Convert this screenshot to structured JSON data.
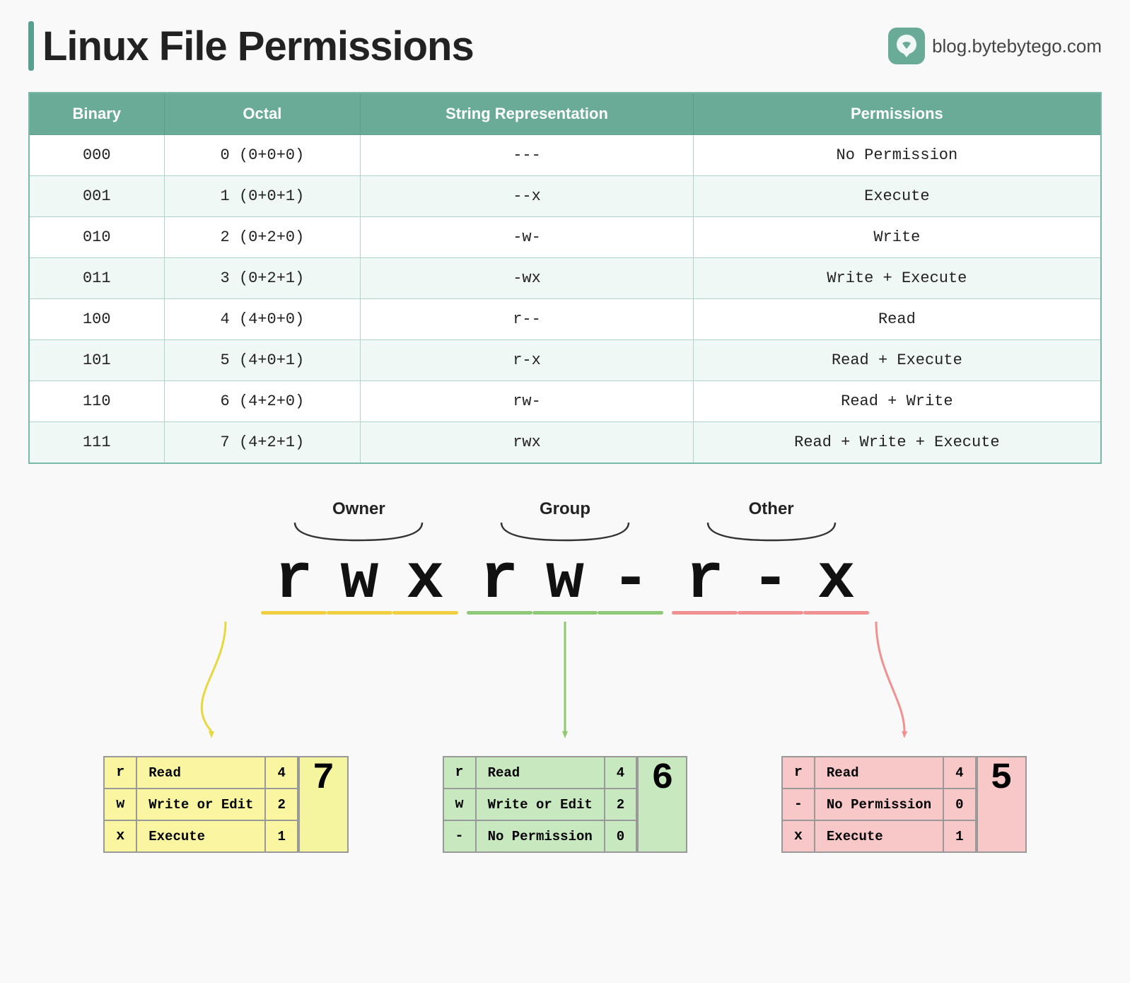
{
  "header": {
    "title": "Linux File Permissions",
    "url": "blog.bytebytego.com"
  },
  "table": {
    "headers": [
      "Binary",
      "Octal",
      "String Representation",
      "Permissions"
    ],
    "rows": [
      {
        "binary": "000",
        "octal": "0 (0+0+0)",
        "string": "---",
        "permission": "No Permission"
      },
      {
        "binary": "001",
        "octal": "1 (0+0+1)",
        "string": "--x",
        "permission": "Execute"
      },
      {
        "binary": "010",
        "octal": "2 (0+2+0)",
        "string": "-w-",
        "permission": "Write"
      },
      {
        "binary": "011",
        "octal": "3 (0+2+1)",
        "string": "-wx",
        "permission": "Write + Execute"
      },
      {
        "binary": "100",
        "octal": "4 (4+0+0)",
        "string": "r--",
        "permission": "Read"
      },
      {
        "binary": "101",
        "octal": "5 (4+0+1)",
        "string": "r-x",
        "permission": "Read + Execute"
      },
      {
        "binary": "110",
        "octal": "6 (4+2+0)",
        "string": "rw-",
        "permission": "Read + Write"
      },
      {
        "binary": "111",
        "octal": "7 (4+2+1)",
        "string": "rwx",
        "permission": "Read + Write + Execute"
      }
    ]
  },
  "visualization": {
    "groups": [
      {
        "label": "Owner",
        "chars": [
          "r",
          "w",
          "x"
        ],
        "color": "yellow"
      },
      {
        "label": "Group",
        "chars": [
          "r",
          "w",
          "-"
        ],
        "color": "green"
      },
      {
        "label": "Other",
        "chars": [
          "r",
          "-",
          "x"
        ],
        "color": "pink"
      }
    ],
    "perm_string": [
      "r",
      "w",
      "x",
      "r",
      "w",
      "-",
      "r",
      "-",
      "x"
    ]
  },
  "boxes": {
    "owner": {
      "label": "Owner",
      "total": "7",
      "bg": "yellow",
      "rows": [
        {
          "key": "r",
          "desc": "Read",
          "val": "4"
        },
        {
          "key": "w",
          "desc": "Write or Edit",
          "val": "2"
        },
        {
          "key": "x",
          "desc": "Execute",
          "val": "1"
        }
      ]
    },
    "group": {
      "label": "Group",
      "total": "6",
      "bg": "green",
      "rows": [
        {
          "key": "r",
          "desc": "Read",
          "val": "4"
        },
        {
          "key": "w",
          "desc": "Write or Edit",
          "val": "2"
        },
        {
          "key": "-",
          "desc": "No Permission",
          "val": "0"
        }
      ]
    },
    "other": {
      "label": "Other",
      "total": "5",
      "bg": "pink",
      "rows": [
        {
          "key": "r",
          "desc": "Read",
          "val": "4"
        },
        {
          "key": "-",
          "desc": "No Permission",
          "val": "0"
        },
        {
          "key": "x",
          "desc": "Execute",
          "val": "1"
        }
      ]
    }
  }
}
